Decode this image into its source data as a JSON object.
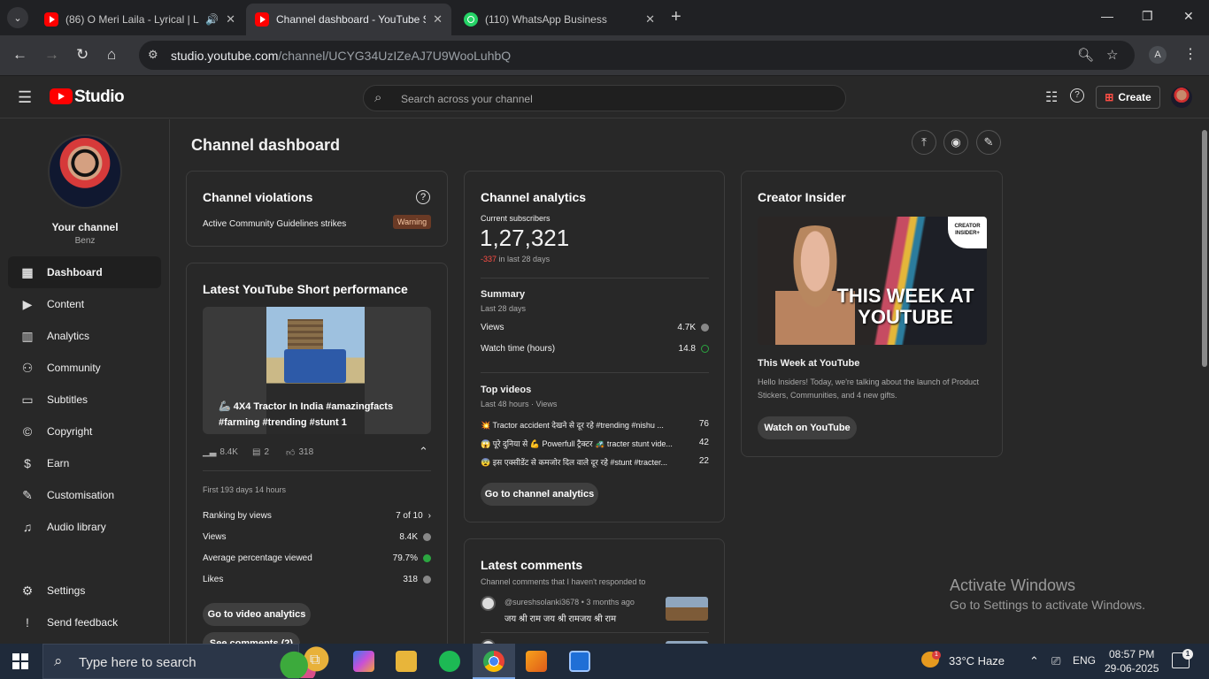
{
  "browser": {
    "tabs": [
      {
        "title": "(86) O Meri Laila - Lyrical | L",
        "icon": "youtube-icon"
      },
      {
        "title": "Channel dashboard - YouTube S",
        "icon": "youtube-icon"
      },
      {
        "title": "(110) WhatsApp Business",
        "icon": "whatsapp-icon"
      }
    ],
    "url_domain": "studio.youtube.com",
    "url_path": "/channel/UCYG34UzIZeAJ7U9WooLuhbQ",
    "profile_initial": "A"
  },
  "studio": {
    "logo_text": "Studio",
    "search_placeholder": "Search across your channel",
    "create_label": "Create"
  },
  "sidebar": {
    "channel_title": "Your channel",
    "channel_name": "Benz",
    "items": [
      {
        "label": "Dashboard",
        "icon": "dashboard-icon",
        "selected": true
      },
      {
        "label": "Content",
        "icon": "content-icon"
      },
      {
        "label": "Analytics",
        "icon": "analytics-icon"
      },
      {
        "label": "Community",
        "icon": "community-icon"
      },
      {
        "label": "Subtitles",
        "icon": "subtitles-icon"
      },
      {
        "label": "Copyright",
        "icon": "copyright-icon"
      },
      {
        "label": "Earn",
        "icon": "earn-icon"
      },
      {
        "label": "Customisation",
        "icon": "customisation-icon"
      },
      {
        "label": "Audio library",
        "icon": "audio-library-icon"
      }
    ],
    "bottom_items": [
      {
        "label": "Settings",
        "icon": "gear-icon"
      },
      {
        "label": "Send feedback",
        "icon": "feedback-icon"
      }
    ]
  },
  "dashboard": {
    "title": "Channel dashboard",
    "violations": {
      "title": "Channel violations",
      "strikes_label": "Active Community Guidelines strikes",
      "badge": "Warning"
    },
    "short": {
      "title": "Latest YouTube Short performance",
      "caption_line1": "🦾 4X4 Tractor In India #amazingfacts",
      "caption_line2": "#farming #trending #stunt 1",
      "views": "8.4K",
      "comments": "2",
      "likes": "318",
      "period": "First 193 days 14 hours",
      "stats": [
        {
          "label": "Ranking by views",
          "value": "7 of 10"
        },
        {
          "label": "Views",
          "value": "8.4K"
        },
        {
          "label": "Average percentage viewed",
          "value": "79.7%"
        },
        {
          "label": "Likes",
          "value": "318"
        }
      ],
      "analytics_button": "Go to video analytics",
      "comments_button": "See comments (2)"
    },
    "analytics": {
      "title": "Channel analytics",
      "subs_label": "Current subscribers",
      "subs_value": "1,27,321",
      "subs_change": "-337",
      "subs_change_period": "in last 28 days",
      "summary_title": "Summary",
      "summary_period": "Last 28 days",
      "summary": [
        {
          "label": "Views",
          "value": "4.7K"
        },
        {
          "label": "Watch time (hours)",
          "value": "14.8"
        }
      ],
      "top_title": "Top videos",
      "top_period": "Last 48 hours · Views",
      "top_videos": [
        {
          "title": "💥 Tractor accident देखने से दूर रहे #trending #nishu ...",
          "views": "76"
        },
        {
          "title": "😱 पूरे दुनिया से 💪 Powerfull ट्रैक्टर 🚜 tracter stunt vide...",
          "views": "42"
        },
        {
          "title": "😨 इस एक्सीडेंट से कमजोर दिल वाले दूर रहे #stunt #tracter...",
          "views": "22"
        }
      ],
      "button": "Go to channel analytics"
    },
    "comments": {
      "title": "Latest comments",
      "subtitle": "Channel comments that I haven't responded to",
      "items": [
        {
          "author": "@sureshsolanki3678",
          "time": "3 months ago",
          "text": "जय श्री राम जय श्री रामजय श्री राम"
        }
      ]
    },
    "insider": {
      "title": "Creator Insider",
      "image_text": "THIS WEEK AT YOUTUBE",
      "badge": "CREATOR INSIDER+",
      "video_title": "This Week at YouTube",
      "description": "Hello Insiders! Today, we're talking about the launch of Product Stickers, Communities, and 4 new gifts.",
      "button": "Watch on YouTube"
    }
  },
  "watermark": {
    "line1": "Activate Windows",
    "line2": "Go to Settings to activate Windows."
  },
  "taskbar": {
    "search_placeholder": "Type here to search",
    "weather": "33°C  Haze",
    "language": "ENG",
    "time": "08:57 PM",
    "date": "29-06-2025",
    "weather_badge": "1",
    "notification_count": "1"
  }
}
